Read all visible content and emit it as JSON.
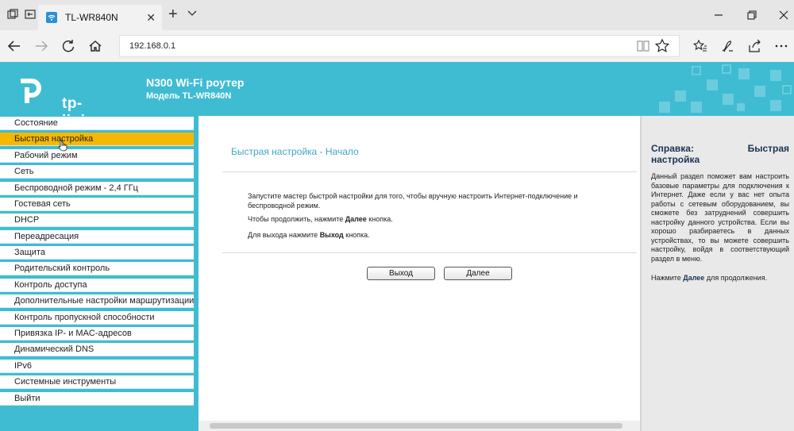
{
  "browser": {
    "tab_title": "TL-WR840N",
    "url": "192.168.0.1"
  },
  "header": {
    "logo_text": "tp-link",
    "title": "N300 Wi-Fi роутер",
    "model": "Модель TL-WR840N"
  },
  "sidebar": {
    "items": [
      {
        "label": "Состояние"
      },
      {
        "label": "Быстрая настройка",
        "active": true
      },
      {
        "label": "Рабочий режим"
      },
      {
        "label": "Сеть"
      },
      {
        "label": "Беспроводной режим - 2,4 ГГц"
      },
      {
        "label": "Гостевая сеть"
      },
      {
        "label": "DHCP"
      },
      {
        "label": "Переадресация"
      },
      {
        "label": "Защита"
      },
      {
        "label": "Родительский контроль"
      },
      {
        "label": "Контроль доступа"
      },
      {
        "label": "Дополнительные настройки маршрутизации"
      },
      {
        "label": "Контроль пропускной способности"
      },
      {
        "label": "Привязка IP- и MAC-адресов"
      },
      {
        "label": "Динамический DNS"
      },
      {
        "label": "IPv6"
      },
      {
        "label": "Системные инструменты"
      },
      {
        "label": "Выйти"
      }
    ]
  },
  "main": {
    "title": "Быстрая настройка - Начало",
    "p1": "Запустите мастер быстрой настройки для того, чтобы вручную настроить Интернет-подключение и беспроводной режим.",
    "p2_pre": "Чтобы продолжить, нажмите ",
    "p2_bold": "Далее",
    "p2_post": " кнопка.",
    "p3_pre": "Для выхода нажмите ",
    "p3_bold": "Выход",
    "p3_post": " кнопка.",
    "exit_label": "Выход",
    "next_label": "Далее"
  },
  "help": {
    "title": "Справка: Быстрая настройка",
    "body": "Данный раздел поможет вам настроить базовые параметры для подключения к Интернет. Даже если у вас нет опыта работы с сетевым оборудованием, вы сможете без затруднений совершить настройку данного устройства. Если вы хорошо разбираетесь в данных устройствах, то вы можете совершить настройку, войдя в соответствующий раздел в меню.",
    "next_pre": "Нажмите ",
    "next_bold": "Далее",
    "next_post": " для продолжения."
  },
  "colors": {
    "brand": "#3fbcd2",
    "active_menu": "#f5b800",
    "title_blue": "#3fa7c4"
  }
}
